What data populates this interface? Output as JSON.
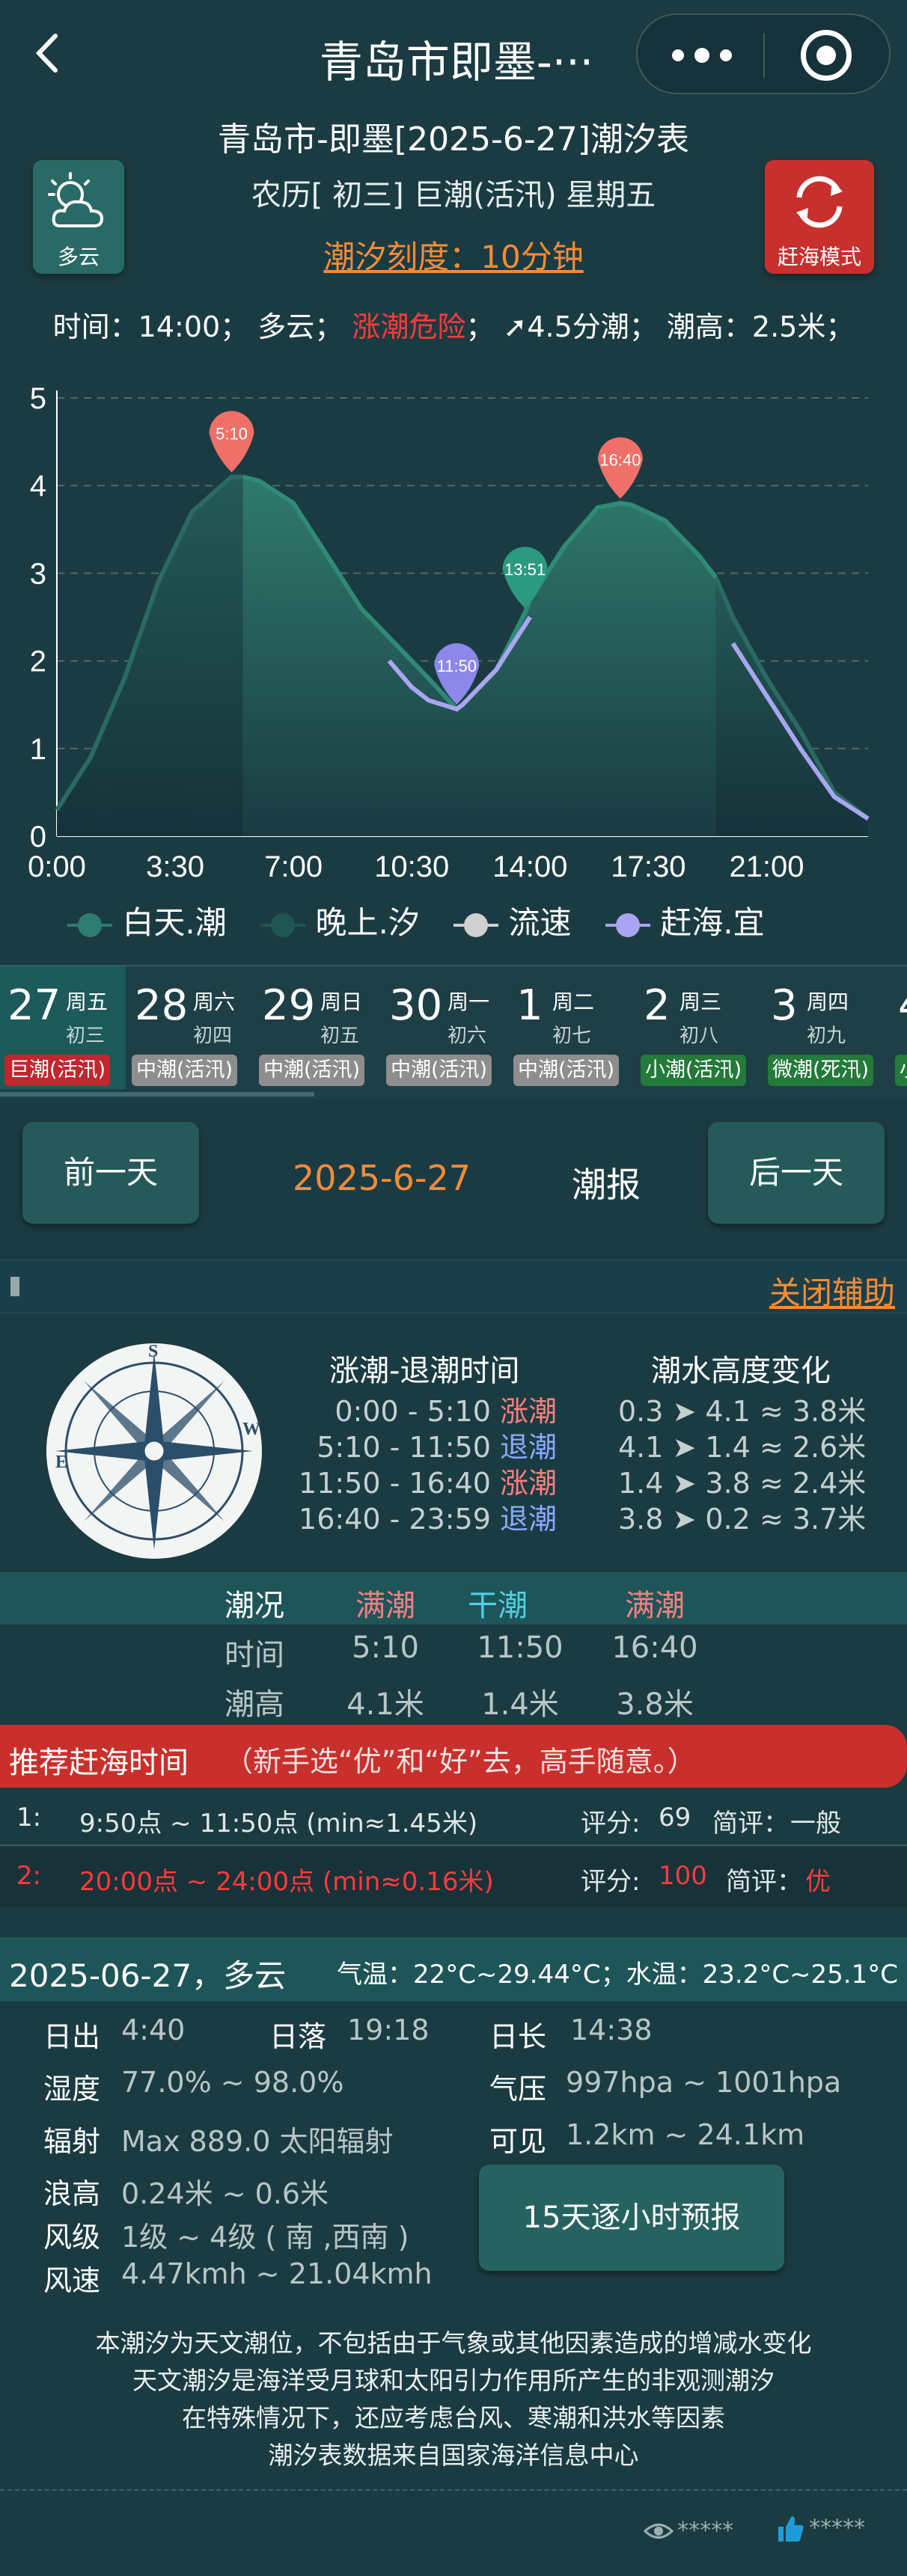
{
  "nav": {
    "title": "青岛市即墨-···",
    "back_icon": "chevron-left-icon",
    "more_icon": "more-icon",
    "close_icon": "target-icon"
  },
  "header": {
    "title": "青岛市-即墨[2025-6-27]潮汐表",
    "lunar": "农历[ 初三] 巨潮(活汛) 星期五",
    "scale_link": "潮汐刻度：10分钟",
    "weather_label": "多云",
    "weather_icon": "cloud-sun-icon",
    "mode_label": "赶海模式",
    "mode_icon": "refresh-icon"
  },
  "status": {
    "time": "时间：14:00；",
    "weather": "多云；",
    "danger": "涨潮危险",
    "sep": "；",
    "flow": "➚4.5分潮；",
    "height": "潮高：2.5米；"
  },
  "chart_data": {
    "type": "area",
    "xlabel": "",
    "ylabel": "",
    "x_ticks": [
      "0:00",
      "3:30",
      "7:00",
      "10:30",
      "14:00",
      "17:30",
      "21:00"
    ],
    "y_ticks": [
      "0",
      "1",
      "2",
      "3",
      "4",
      "5"
    ],
    "ylim": [
      0,
      5
    ],
    "xlim_hours": [
      0,
      24
    ],
    "grid": true,
    "series": [
      {
        "name": "白天.潮",
        "x_hours": [
          5.5,
          6,
          7,
          8,
          9,
          10,
          11,
          11.83,
          12,
          13,
          13.85,
          14,
          15,
          16,
          16.67,
          17,
          18,
          19,
          19.5
        ],
        "y": [
          4.1,
          4.05,
          3.8,
          3.2,
          2.6,
          2.2,
          1.8,
          1.45,
          1.5,
          1.9,
          2.55,
          2.7,
          3.3,
          3.75,
          3.8,
          3.78,
          3.6,
          3.2,
          2.95
        ]
      },
      {
        "name": "晚上.汐",
        "x_hours": [
          0,
          0.5,
          1,
          2,
          3,
          4,
          5.17,
          5.5
        ],
        "y": [
          0.3,
          0.6,
          0.9,
          1.8,
          2.9,
          3.7,
          4.1,
          4.1
        ]
      },
      {
        "name": "晚上.汐",
        "x_hours": [
          19.5,
          20,
          21,
          22,
          23,
          24
        ],
        "y": [
          2.95,
          2.5,
          1.8,
          1.2,
          0.5,
          0.2
        ]
      },
      {
        "name": "流速",
        "x_hours": [],
        "y": []
      },
      {
        "name": "赶海.宜",
        "x_hours": [
          9.83,
          10.5,
          11,
          11.83,
          12,
          13,
          14
        ],
        "y": [
          2.0,
          1.7,
          1.55,
          1.45,
          1.5,
          1.9,
          2.5
        ]
      },
      {
        "name": "赶海.宜",
        "x_hours": [
          20,
          21,
          22,
          23,
          24
        ],
        "y": [
          2.2,
          1.6,
          1.0,
          0.45,
          0.2
        ]
      }
    ],
    "annotations": [
      {
        "label": "5:10",
        "x_hours": 5.17,
        "y": 4.1,
        "color": "#ef7068"
      },
      {
        "label": "11:50",
        "x_hours": 11.83,
        "y": 1.45,
        "color": "#8c87e8"
      },
      {
        "label": "13:51",
        "x_hours": 13.85,
        "y": 2.55,
        "color": "#2a9a80"
      },
      {
        "label": "16:40",
        "x_hours": 16.67,
        "y": 3.8,
        "color": "#ef7068"
      }
    ],
    "legend": [
      "白天.潮",
      "晚上.汐",
      "流速",
      "赶海.宜"
    ],
    "legend_placement": "bottom",
    "colors": {
      "day": "#2d7d70",
      "night": "#1c4c4c",
      "speed": "#d0d0d0",
      "catch": "#a9a5f0"
    }
  },
  "calendar": {
    "days": [
      {
        "num": "27",
        "week": "周五",
        "lunar": "初三",
        "tag": "巨潮(活汛)",
        "tag_color": "#c2262e",
        "active": true
      },
      {
        "num": "28",
        "week": "周六",
        "lunar": "初四",
        "tag": "中潮(活汛)",
        "tag_color": "#8e8e8e"
      },
      {
        "num": "29",
        "week": "周日",
        "lunar": "初五",
        "tag": "中潮(活汛)",
        "tag_color": "#8e8e8e"
      },
      {
        "num": "30",
        "week": "周一",
        "lunar": "初六",
        "tag": "中潮(活汛)",
        "tag_color": "#8e8e8e"
      },
      {
        "num": "1",
        "week": "周二",
        "lunar": "初七",
        "tag": "中潮(活汛)",
        "tag_color": "#8e8e8e"
      },
      {
        "num": "2",
        "week": "周三",
        "lunar": "初八",
        "tag": "小潮(活汛)",
        "tag_color": "#237a3a"
      },
      {
        "num": "3",
        "week": "周四",
        "lunar": "初九",
        "tag": "微潮(死汛)",
        "tag_color": "#237a3a"
      },
      {
        "num": "4",
        "week": "",
        "lunar": "",
        "tag": "小",
        "tag_color": "#237a3a"
      }
    ]
  },
  "daynav": {
    "prev": "前一天",
    "date": "2025-6-27",
    "report": "潮报",
    "next": "后一天"
  },
  "assist": {
    "close": "关闭辅助"
  },
  "tide_times": {
    "compass_icon": "compass-icon",
    "title_left": "涨潮-退潮时间",
    "title_right": "潮水高度变化",
    "rows": [
      {
        "range": "0:00 - 5:10 ",
        "type": "涨潮",
        "change": "0.3 ➤ 4.1 ≈ 3.8米",
        "color": "#f58080"
      },
      {
        "range": "5:10 - 11:50 ",
        "type": "退潮",
        "change": "4.1 ➤ 1.4 ≈ 2.6米",
        "color": "#8aa8ff"
      },
      {
        "range": "11:50 - 16:40 ",
        "type": "涨潮",
        "change": "1.4 ➤ 3.8 ≈ 2.4米",
        "color": "#f58080"
      },
      {
        "range": "16:40 - 23:59 ",
        "type": "退潮",
        "change": "3.8 ➤ 0.2 ≈ 3.7米",
        "color": "#8aa8ff"
      }
    ]
  },
  "tide_table": {
    "head": [
      "潮况",
      "满潮",
      "干潮",
      "满潮"
    ],
    "time_label": "时间",
    "times": [
      "5:10",
      "11:50",
      "16:40"
    ],
    "height_label": "潮高",
    "heights": [
      "4.1米",
      "1.4米",
      "3.8米"
    ]
  },
  "recommend": {
    "title": "推荐赶海时间",
    "note": "（新手选“优”和“好”去，高手随意。）",
    "items": [
      {
        "idx": "1:",
        "time": "9:50点 ~ 11:50点 (min≈1.45米)",
        "score_label": "评分: ",
        "score": "69",
        "comment_label": "简评：",
        "comment": "一般",
        "highlight": false
      },
      {
        "idx": "2:",
        "time": "20:00点 ~ 24:00点 (min≈0.16米)",
        "score_label": "评分: ",
        "score": "100",
        "comment_label": "简评：",
        "comment": "优",
        "highlight": true
      }
    ]
  },
  "weather": {
    "title": "2025-06-27，多云",
    "temps": "气温：22°C~29.44°C；水温：23.2°C~25.1°C",
    "sunrise_label": "日出",
    "sunrise": "4:40",
    "sunset_label": "日落",
    "sunset": "19:18",
    "daylen_label": "日长",
    "daylen": "14:38",
    "humidity_label": "湿度",
    "humidity": "77.0% ~ 98.0%",
    "pressure_label": "气压",
    "pressure": "997hpa ~ 1001hpa",
    "radiation_label": "辐射",
    "radiation": "Max 889.0 太阳辐射",
    "visibility_label": "可见",
    "visibility": "1.2km ~ 24.1km",
    "wave_label": "浪高",
    "wave": "0.24米 ~ 0.6米",
    "wind_label": "风级",
    "wind": "1级 ~ 4级 ( 南 ,西南 )",
    "speed_label": "风速",
    "speed": "4.47kmh ~ 21.04kmh",
    "forecast_button": "15天逐小时预报"
  },
  "footer": {
    "lines": [
      "本潮汐为天文潮位，不包括由于气象或其他因素造成的增减水变化",
      "天文潮汐是海洋受月球和太阳引力作用所产生的非观测潮汐",
      "在特殊情况下，还应考虑台风、寒潮和洪水等因素",
      "潮汐表数据来自国家海洋信息中心"
    ],
    "views": "*****",
    "likes": "*****",
    "eye_icon": "eye-icon",
    "thumb_icon": "thumbs-up-icon"
  }
}
